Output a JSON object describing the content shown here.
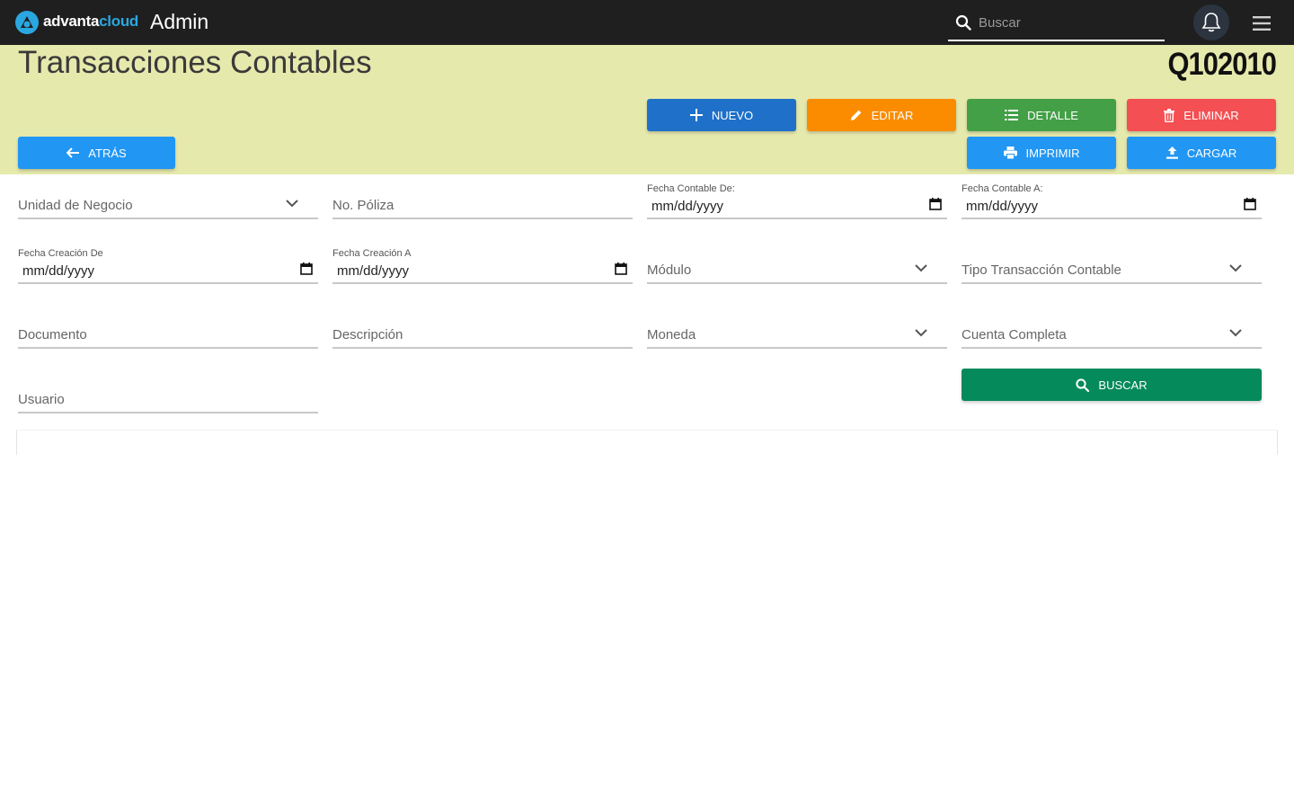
{
  "topbar": {
    "brand_part1": "advanta",
    "brand_part2": "cloud",
    "app_title": "Admin",
    "search_placeholder": "Buscar",
    "brand_color": "#2aa7e0"
  },
  "header": {
    "title": "Transacciones Contables",
    "code": "Q102010",
    "band_color": "#e6e9ac"
  },
  "actions": {
    "nuevo": "NUEVO",
    "editar": "EDITAR",
    "detalle": "DETALLE",
    "eliminar": "ELIMINAR",
    "atras": "ATRÁS",
    "imprimir": "IMPRIMIR",
    "cargar": "CARGAR"
  },
  "filters": {
    "unidad_negocio": "Unidad de Negocio",
    "no_poliza": "No. Póliza",
    "fecha_contable_de": {
      "label": "Fecha Contable De:",
      "value": "mm/dd/yyyy"
    },
    "fecha_contable_a": {
      "label": "Fecha Contable A:",
      "value": "mm/dd/yyyy"
    },
    "fecha_creacion_de": {
      "label": "Fecha Creación De",
      "value": "mm/dd/yyyy"
    },
    "fecha_creacion_a": {
      "label": "Fecha Creación A",
      "value": "mm/dd/yyyy"
    },
    "modulo": "Módulo",
    "tipo_transaccion": "Tipo Transacción Contable",
    "documento": "Documento",
    "descripcion": "Descripción",
    "moneda": "Moneda",
    "cuenta_completa": "Cuenta Completa",
    "usuario": "Usuario",
    "buscar": "BUSCAR"
  },
  "icons": {
    "logo": "advanta-logo-icon",
    "search": "search-icon",
    "bell": "bell-icon",
    "menu": "hamburger-menu-icon",
    "plus": "plus-icon",
    "pencil": "pencil-icon",
    "list": "list-icon",
    "trash": "trash-icon",
    "arrow_left": "arrow-left-icon",
    "printer": "printer-icon",
    "upload": "upload-icon",
    "chevron": "chevron-down-icon",
    "calendar": "calendar-icon"
  }
}
